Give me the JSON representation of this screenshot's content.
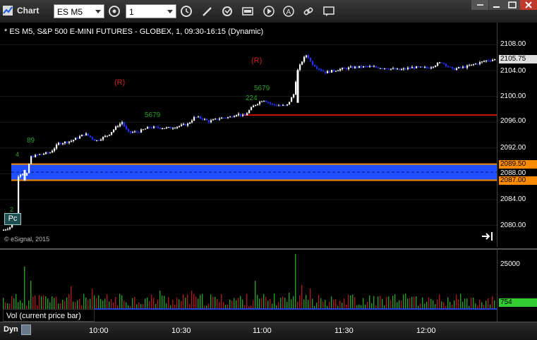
{
  "window": {
    "title": "Chart"
  },
  "toolbar": {
    "symbol": "ES M5",
    "interval": "1"
  },
  "chart": {
    "title": "* ES M5, S&P 500 E-MINI FUTURES - GLOBEX, 1, 09:30-16:15 (Dynamic)",
    "copyright": "© eSignal, 2015",
    "markers": [
      {
        "text": "(R)",
        "color": "#cc2222"
      },
      {
        "text": "(R)",
        "color": "#cc2222"
      },
      {
        "text": "Pc",
        "color": "#ffffff"
      }
    ],
    "annotations": [
      "89",
      "5679",
      "5679",
      "224",
      "2",
      "4"
    ],
    "price_axis": {
      "labels": [
        "2108.00",
        "2104.00",
        "2100.00",
        "2096.00",
        "2092.00",
        "2088.00",
        "2084.00",
        "2080.00"
      ],
      "last_price": "2105.75",
      "zone_top": "2089.50",
      "zone_bottom": "2087.00",
      "last_price_color": "#e0e0e0",
      "zone_tag_color": "#ff8c00"
    },
    "volume": {
      "legend": "Vol (current price bar)",
      "axis_label": "25000",
      "last_volume": "754",
      "last_volume_color": "#33cc33"
    },
    "time_axis": {
      "mode": "Dyn",
      "labels": [
        "10:00",
        "10:30",
        "11:00",
        "11:30",
        "12:00"
      ]
    },
    "colors": {
      "up_bar": "#ffffff",
      "down_bar": "#2233ff",
      "zone_fill": "#1f4fff",
      "zone_border": "#ff8c00",
      "resistance_line": "#cc1111",
      "vol_up": "#2a9a2a",
      "vol_down": "#aa1a1a"
    }
  }
}
